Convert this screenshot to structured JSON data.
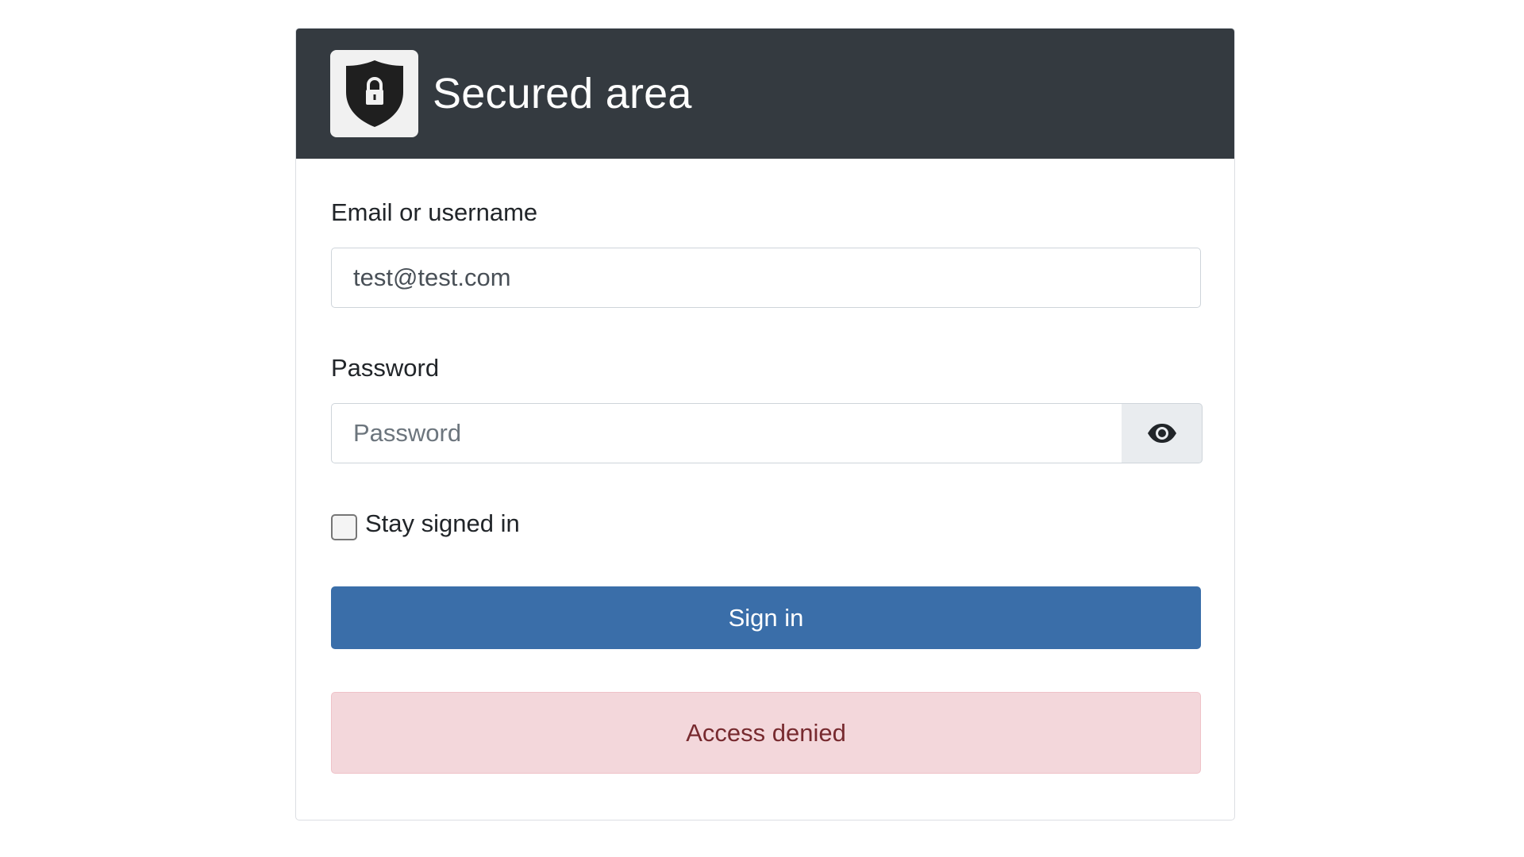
{
  "header": {
    "title": "Secured area",
    "logo_icon": "shield-lock-icon"
  },
  "form": {
    "email_label": "Email or username",
    "email_value": "test@test.com",
    "password_label": "Password",
    "password_value": "",
    "password_placeholder": "Password",
    "toggle_icon": "eye-icon",
    "remember_label": "Stay signed in",
    "remember_checked": false,
    "submit_label": "Sign in"
  },
  "alert": {
    "message": "Access denied"
  },
  "colors": {
    "header_bg": "#343a40",
    "button_bg": "#3a6ea9",
    "alert_bg": "#f3d7db",
    "alert_text": "#772a2f"
  }
}
